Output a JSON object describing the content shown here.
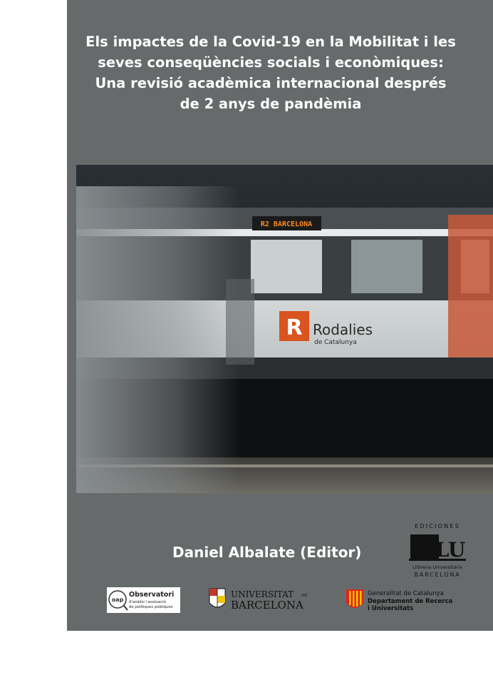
{
  "title_lines": [
    "Els impactes de la Covid-19 en la Mobilitat i les",
    "seves conseqüències socials i econòmiques:",
    "Una revisió acadèmica internacional després",
    "de 2 anys de pandèmia"
  ],
  "photo": {
    "destination_sign": "R2 BARCELONA",
    "brand_name": "Rodalies",
    "brand_sub": "de Catalunya",
    "brand_letter": "R"
  },
  "editor": "Daniel Albalate (Editor)",
  "publisher": {
    "top": "EDICIONES",
    "mark": "LU",
    "line1": "Llibreria Universitària",
    "line2": "BARCELONA"
  },
  "logos": {
    "oap_mark": "oap",
    "oap_title": "Observatori",
    "oap_sub1": "d'anàlisi i avaluació",
    "oap_sub2": "de polítiques públiques",
    "ub_line1": "UNIVERSITAT",
    "ub_de": "DE",
    "ub_line2": "BARCELONA",
    "gen_line1": "Generalitat de Catalunya",
    "gen_line2": "Departament de Recerca",
    "gen_line3": "i Universitats"
  },
  "colors": {
    "cover": "#666a6b",
    "sign_text": "#ff8a1e",
    "brand_orange": "#d9541e"
  }
}
